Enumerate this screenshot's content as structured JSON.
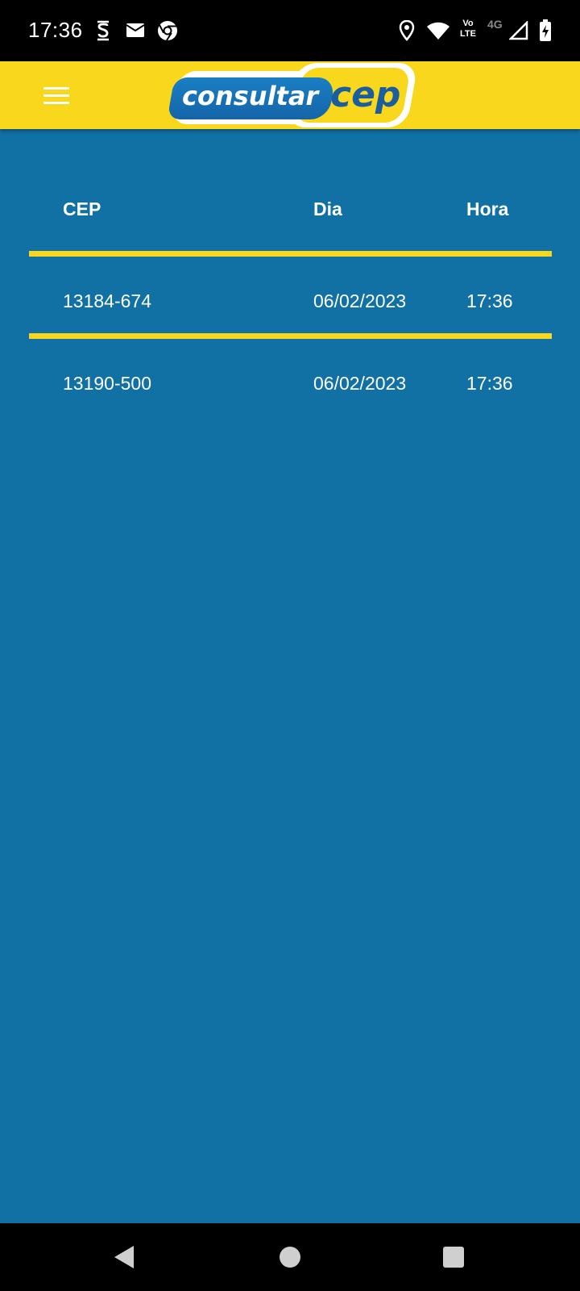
{
  "status_bar": {
    "time": "17:36",
    "notification_icons": [
      "s-app-icon",
      "mail-icon",
      "chrome-icon"
    ],
    "system_icons": [
      "location-icon",
      "wifi-icon",
      "volte-icon",
      "signal-icon",
      "battery-charging-icon"
    ],
    "volte_label_top": "Vo",
    "volte_label_bottom": "LTE",
    "network_type": "4G"
  },
  "app_bar": {
    "logo_text_left": "consultar",
    "logo_text_right": "cep",
    "colors": {
      "bar": "#F9D71C",
      "logo_blue": "#1565A8"
    }
  },
  "table": {
    "headers": {
      "cep": "CEP",
      "dia": "Dia",
      "hora": "Hora"
    },
    "rows": [
      {
        "cep": "13184-674",
        "dia": "06/02/2023",
        "hora": "17:36"
      },
      {
        "cep": "13190-500",
        "dia": "06/02/2023",
        "hora": "17:36"
      }
    ],
    "colors": {
      "background": "#1170A4",
      "divider": "#F9D71C",
      "text": "#FFFFFF"
    }
  },
  "nav_bar": {
    "buttons": [
      "back-icon",
      "home-icon",
      "recent-apps-icon"
    ]
  }
}
